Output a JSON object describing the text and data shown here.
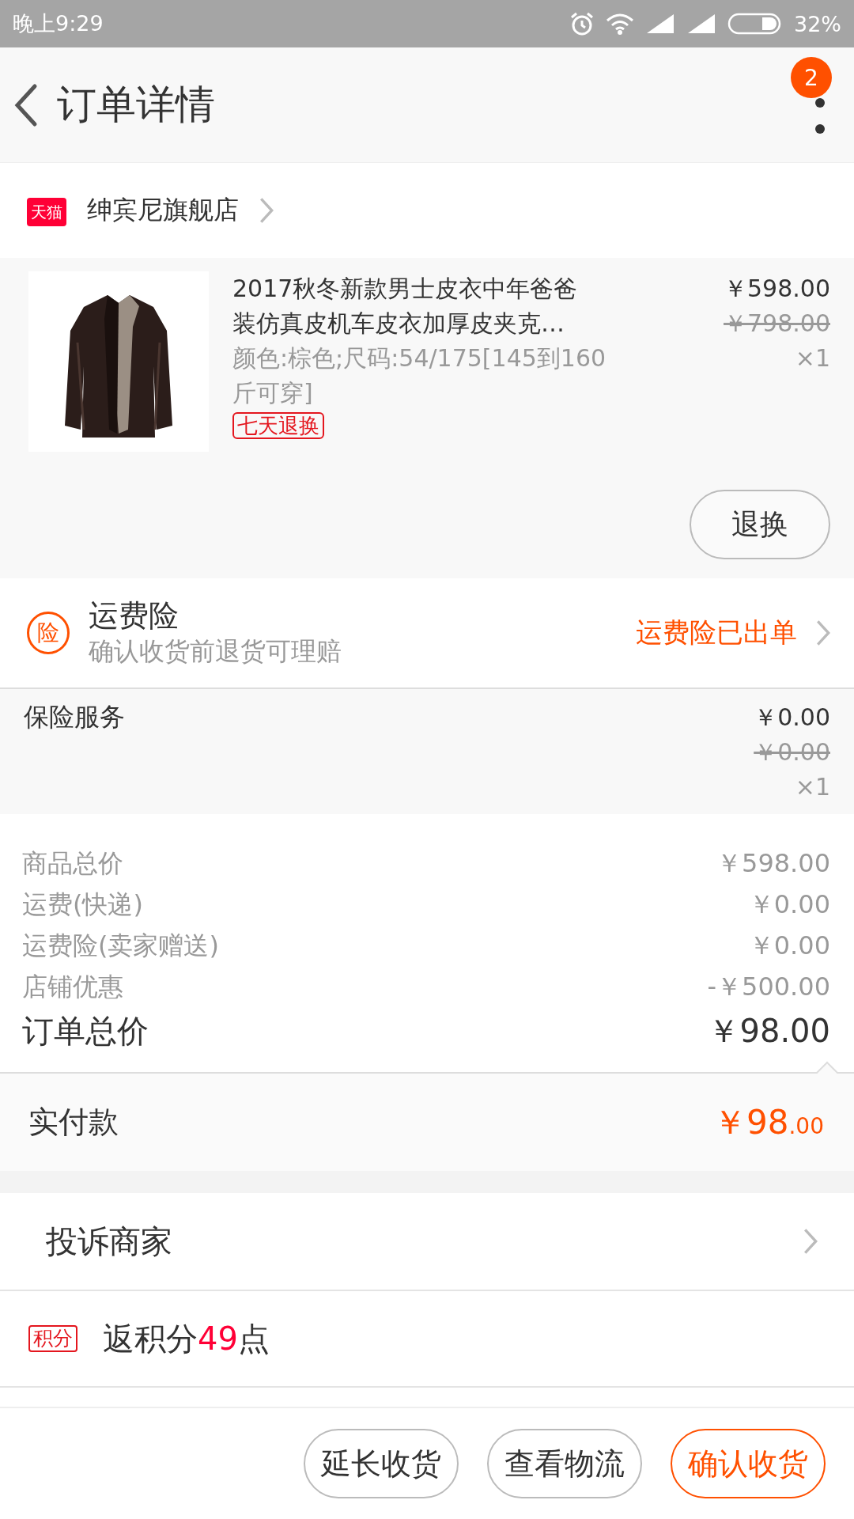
{
  "status_bar": {
    "time": "晚上9:29",
    "battery": "32%"
  },
  "header": {
    "title": "订单详情",
    "badge": "2"
  },
  "shop": {
    "logo_text": "天猫",
    "name": "绅宾尼旗舰店"
  },
  "product": {
    "title_lines": [
      "2017秋冬新款男士皮衣中年爸爸",
      "装仿真皮机车皮衣加厚皮夹克…"
    ],
    "spec": "颜色:棕色;尺码:54/175[145到160斤可穿]",
    "tag": "七天退换",
    "price": "￥598.00",
    "original_price": "￥798.00",
    "quantity": "×1",
    "action": "退换"
  },
  "insurance": {
    "icon_text": "险",
    "title": "运费险",
    "subtitle": "确认收货前退货可理赔",
    "status": "运费险已出单"
  },
  "service": {
    "name": "保险服务",
    "price": "￥0.00",
    "original_price": "￥0.00",
    "quantity": "×1"
  },
  "summary": [
    {
      "kind": "item",
      "label": "商品总价",
      "value": "￥598.00"
    },
    {
      "kind": "item",
      "label": "运费(快递)",
      "value": "￥0.00"
    },
    {
      "kind": "item",
      "label": "运费险(卖家赠送)",
      "value": "￥0.00"
    },
    {
      "kind": "item",
      "label": "店铺优惠",
      "value": "-￥500.00"
    },
    {
      "kind": "total",
      "label": "订单总价",
      "value": "￥98.00"
    }
  ],
  "paid": {
    "label": "实付款",
    "amount": "￥98",
    "cents": ".00"
  },
  "complaint": {
    "label": "投诉商家"
  },
  "points": {
    "badge": "积分",
    "prefix": "返积分",
    "number": "49",
    "suffix": "点"
  },
  "buttons": [
    {
      "kind": "outline",
      "label": "延长收货"
    },
    {
      "kind": "outline",
      "label": "查看物流"
    },
    {
      "kind": "primary",
      "label": "确认收货"
    }
  ]
}
